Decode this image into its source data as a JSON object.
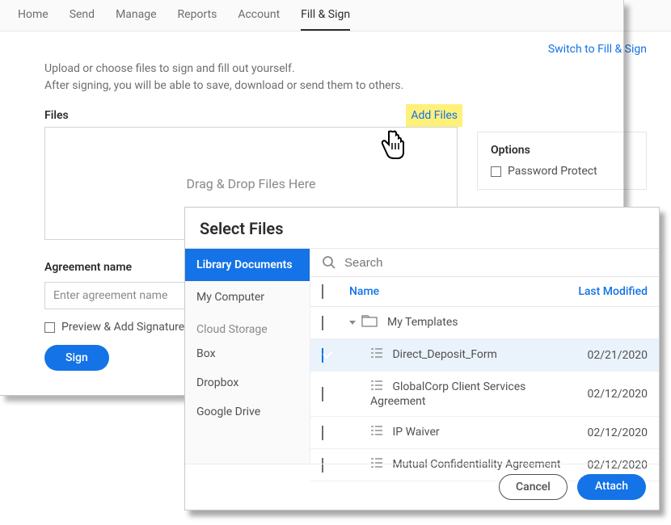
{
  "nav": {
    "tabs": [
      "Home",
      "Send",
      "Manage",
      "Reports",
      "Account",
      "Fill & Sign"
    ],
    "active_index": 5,
    "switch_link": "Switch to Fill & Sign"
  },
  "intro": {
    "line1": "Upload or choose files to sign and fill out yourself.",
    "line2": "After signing, you will be able to save, download or send them to others."
  },
  "files": {
    "title": "Files",
    "add_label": "Add Files",
    "drop_hint": "Drag & Drop Files Here"
  },
  "options": {
    "title": "Options",
    "password_protect": "Password Protect"
  },
  "agreement": {
    "title": "Agreement name",
    "placeholder": "Enter agreement name",
    "preview_label": "Preview & Add Signature Field",
    "sign_label": "Sign"
  },
  "modal": {
    "title": "Select Files",
    "search_placeholder": "Search",
    "sidebar": {
      "items": [
        {
          "label": "Library Documents",
          "active": true
        },
        {
          "label": "My Computer",
          "active": false
        }
      ],
      "cloud_label": "Cloud Storage",
      "cloud_items": [
        "Box",
        "Dropbox",
        "Google Drive"
      ]
    },
    "columns": {
      "name": "Name",
      "modified": "Last Modified"
    },
    "folder": {
      "name": "My Templates"
    },
    "rows": [
      {
        "name": "Direct_Deposit_Form",
        "date": "02/21/2020",
        "checked": true
      },
      {
        "name": "GlobalCorp Client Services Agreement",
        "date": "02/12/2020",
        "checked": false
      },
      {
        "name": "IP Waiver",
        "date": "02/12/2020",
        "checked": false
      },
      {
        "name": "Mutual Confidentiality Agreement",
        "date": "02/12/2020",
        "checked": false
      }
    ],
    "buttons": {
      "cancel": "Cancel",
      "attach": "Attach"
    }
  }
}
